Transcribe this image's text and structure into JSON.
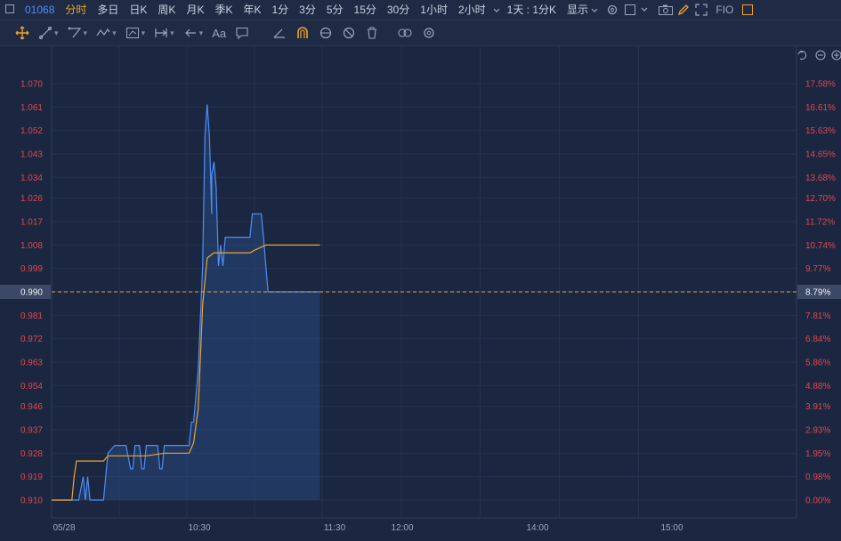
{
  "toolbar": {
    "code": "01068",
    "periods": [
      "分时",
      "多日",
      "日K",
      "周K",
      "月K",
      "季K",
      "年K",
      "1分",
      "3分",
      "5分",
      "15分",
      "30分",
      "1小时",
      "2小时"
    ],
    "active_period": "分时",
    "period_dropdown": "1天 : 1分K",
    "display_label": "显示",
    "fio_label": "FIO"
  },
  "drawing_tools": {
    "text_tool_label": "Aa"
  },
  "colors": {
    "background": "#1b2740",
    "price_line": "#4f8ef7",
    "avg_line": "#f0a32a",
    "axis_text": "#e0454d",
    "current_price_line": "#d9a84a"
  },
  "chart_data": {
    "type": "line",
    "title": "",
    "xlabel": "",
    "ylabel": "",
    "ylim": [
      0.91,
      1.07
    ],
    "yticks_left": [
      "1.070",
      "1.061",
      "1.052",
      "1.043",
      "1.034",
      "1.026",
      "1.017",
      "1.008",
      "0.999",
      "0.990",
      "0.981",
      "0.972",
      "0.963",
      "0.954",
      "0.946",
      "0.937",
      "0.928",
      "0.919",
      "0.910"
    ],
    "yticks_right": [
      "17.58%",
      "16.61%",
      "15.63%",
      "14.65%",
      "13.68%",
      "12.70%",
      "11.72%",
      "10.74%",
      "9.77%",
      "8.79%",
      "7.81%",
      "6.84%",
      "5.86%",
      "4.88%",
      "3.91%",
      "2.93%",
      "1.95%",
      "0.98%",
      "0.00%"
    ],
    "xticks": [
      "05/28",
      "10:30",
      "11:30",
      "12:00",
      "14:00",
      "15:00"
    ],
    "current_price": "0.990",
    "current_change": "8.79%",
    "series": [
      {
        "role": "price",
        "values": [
          [
            "09:30",
            0.91
          ],
          [
            "09:35",
            0.91
          ],
          [
            "09:42",
            0.91
          ],
          [
            "09:44",
            0.919
          ],
          [
            "09:45",
            0.91
          ],
          [
            "09:46",
            0.919
          ],
          [
            "09:47",
            0.91
          ],
          [
            "09:53",
            0.91
          ],
          [
            "09:55",
            0.928
          ],
          [
            "09:58",
            0.931
          ],
          [
            "10:03",
            0.931
          ],
          [
            "10:05",
            0.922
          ],
          [
            "10:06",
            0.922
          ],
          [
            "10:07",
            0.931
          ],
          [
            "10:09",
            0.931
          ],
          [
            "10:10",
            0.922
          ],
          [
            "10:11",
            0.922
          ],
          [
            "10:12",
            0.931
          ],
          [
            "10:17",
            0.931
          ],
          [
            "10:18",
            0.922
          ],
          [
            "10:19",
            0.922
          ],
          [
            "10:20",
            0.931
          ],
          [
            "10:31",
            0.931
          ],
          [
            "10:32",
            0.94
          ],
          [
            "10:33",
            0.94
          ],
          [
            "10:35",
            0.96
          ],
          [
            "10:37",
            1.0
          ],
          [
            "10:38",
            1.05
          ],
          [
            "10:39",
            1.062
          ],
          [
            "10:40",
            1.05
          ],
          [
            "10:41",
            1.02
          ],
          [
            "10:41",
            1.035
          ],
          [
            "10:42",
            1.04
          ],
          [
            "10:43",
            1.03
          ],
          [
            "10:44",
            1.0
          ],
          [
            "10:45",
            1.008
          ],
          [
            "10:46",
            1.0
          ],
          [
            "10:47",
            1.011
          ],
          [
            "10:58",
            1.011
          ],
          [
            "10:59",
            1.02
          ],
          [
            "11:03",
            1.02
          ],
          [
            "11:04",
            1.011
          ],
          [
            "11:05",
            1.0
          ],
          [
            "11:06",
            0.99
          ],
          [
            "11:29",
            0.99
          ]
        ]
      },
      {
        "role": "average",
        "values": [
          [
            "09:30",
            0.91
          ],
          [
            "09:39",
            0.91
          ],
          [
            "09:40",
            0.919
          ],
          [
            "09:41",
            0.925
          ],
          [
            "09:53",
            0.925
          ],
          [
            "09:55",
            0.927
          ],
          [
            "10:12",
            0.927
          ],
          [
            "10:20",
            0.928
          ],
          [
            "10:31",
            0.928
          ],
          [
            "10:33",
            0.932
          ],
          [
            "10:35",
            0.945
          ],
          [
            "10:37",
            0.985
          ],
          [
            "10:39",
            1.003
          ],
          [
            "10:42",
            1.005
          ],
          [
            "10:58",
            1.005
          ],
          [
            "11:00",
            1.006
          ],
          [
            "11:05",
            1.008
          ],
          [
            "11:29",
            1.008
          ]
        ]
      }
    ]
  }
}
